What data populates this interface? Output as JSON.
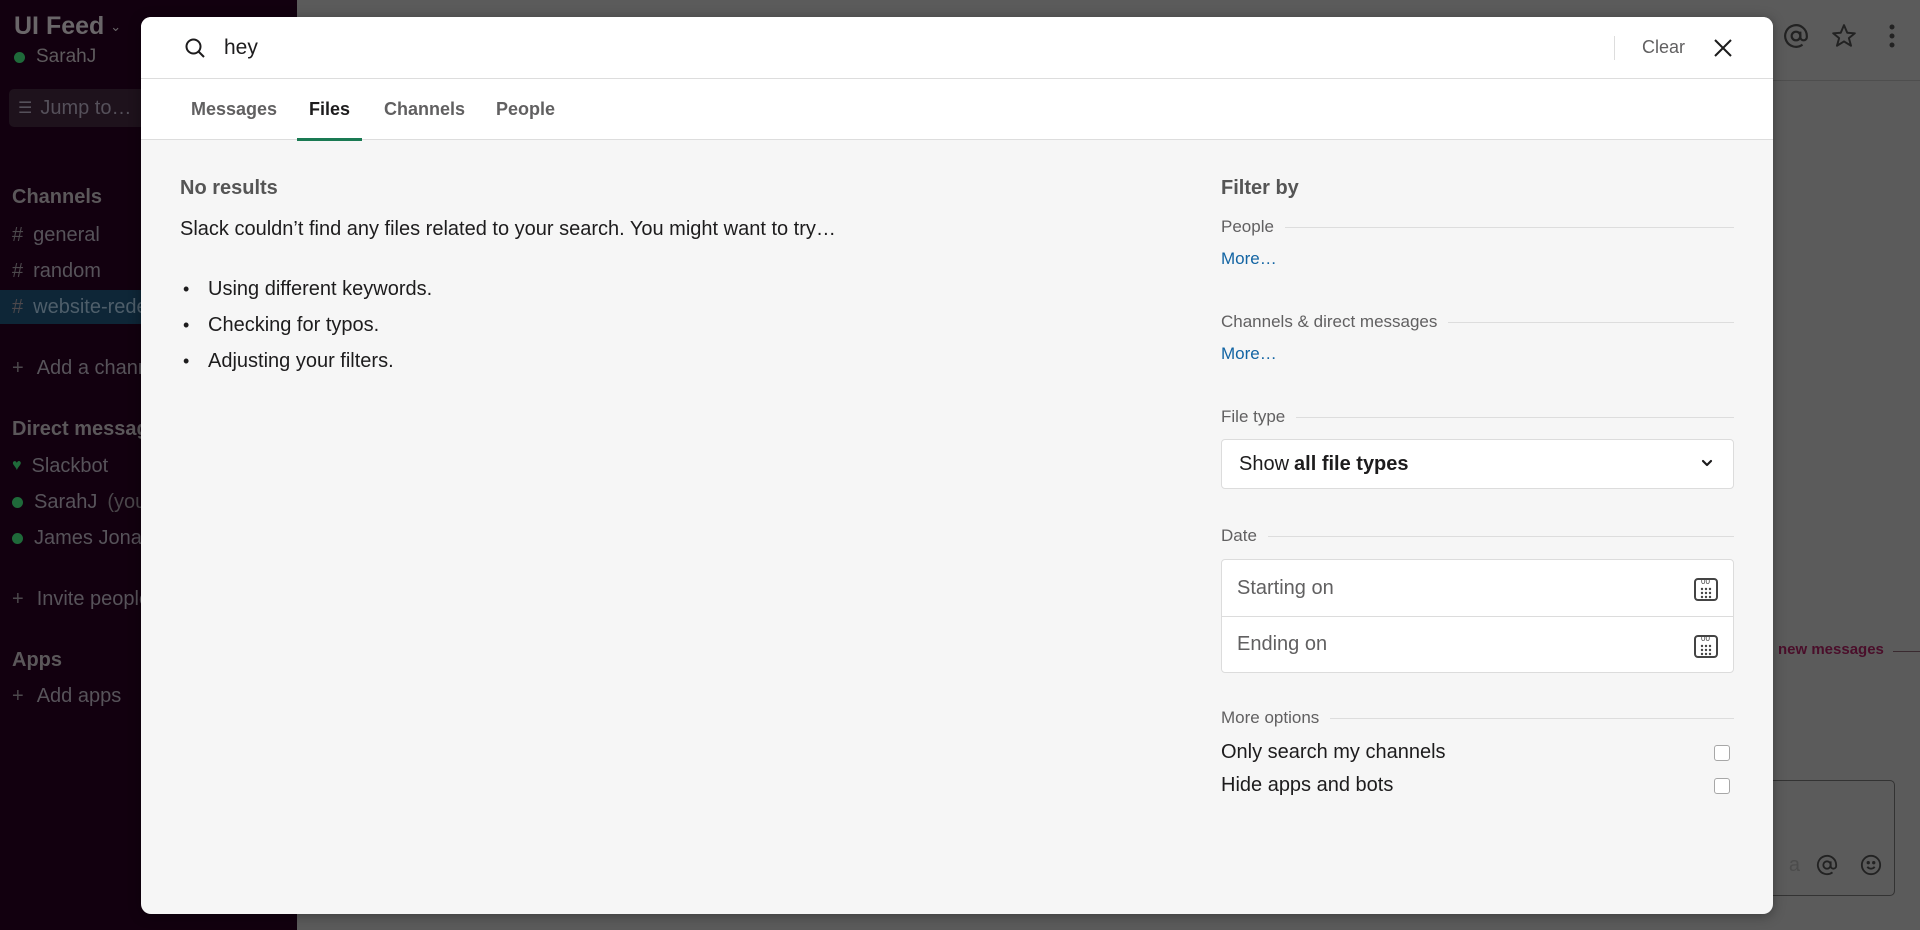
{
  "sidebar": {
    "workspace_name": "UI Feed",
    "workspace_caret": "⌄",
    "user_name": "SarahJ",
    "jump_to": "Jump to…",
    "sections": {
      "channels": "Channels",
      "direct_messages": "Direct messages",
      "apps": "Apps"
    },
    "channels": [
      {
        "name": "general",
        "active": false
      },
      {
        "name": "random",
        "active": false
      },
      {
        "name": "website-redesign",
        "active": true
      }
    ],
    "add_channel": "Add a channel",
    "direct_messages": [
      {
        "name": "Slackbot",
        "status": "heart"
      },
      {
        "name": "SarahJ",
        "suffix": "(you)",
        "status": "online"
      },
      {
        "name": "James Jonas",
        "status": "online"
      }
    ],
    "invite_people": "Invite people",
    "add_apps": "Add apps"
  },
  "background": {
    "new_messages": "new messages",
    "composer_placeholder_tail": "a"
  },
  "search": {
    "query": "hey",
    "clear_label": "Clear",
    "tabs": [
      {
        "label": "Messages",
        "active": false
      },
      {
        "label": "Files",
        "active": true
      },
      {
        "label": "Channels",
        "active": false
      },
      {
        "label": "People",
        "active": false
      }
    ]
  },
  "results": {
    "title": "No results",
    "description": "Slack couldn’t find any files related to your search. You might want to try…",
    "tips": [
      "Using different keywords.",
      "Checking for typos.",
      "Adjusting your filters."
    ]
  },
  "filters": {
    "title": "Filter by",
    "people_label": "People",
    "people_more": "More…",
    "channels_label": "Channels & direct messages",
    "channels_more": "More…",
    "file_type_label": "File type",
    "file_type_prefix": "Show",
    "file_type_value": "all file types",
    "date_label": "Date",
    "starting_on": "Starting on",
    "ending_on": "Ending on",
    "more_options_label": "More options",
    "options": [
      {
        "label": "Only search my channels",
        "checked": false
      },
      {
        "label": "Hide apps and bots",
        "checked": false
      }
    ]
  },
  "colors": {
    "accent_tab": "#1a7a53",
    "link": "#1264a3",
    "sidebar_bg": "#12000f",
    "overlay_bg": "#5b5b5b"
  }
}
